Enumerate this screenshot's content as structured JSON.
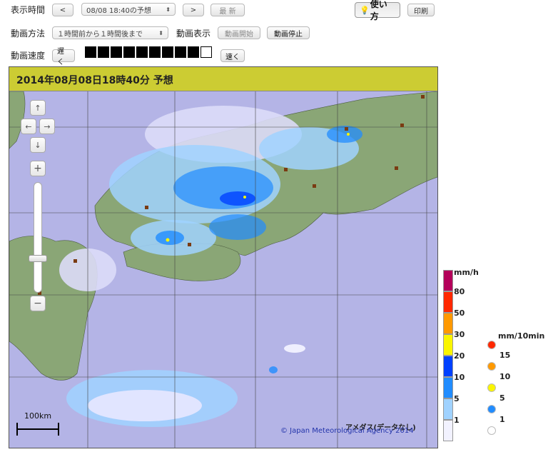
{
  "controls": {
    "display_time_label": "表示時間",
    "prev_button": "<",
    "time_select_value": "08/08 18:40の予想",
    "next_button": ">",
    "latest_button": "最 新",
    "help_button": "使い方",
    "print_button": "印刷",
    "animation_method_label": "動画方法",
    "animation_method_value": "１時間前から１時間後まで",
    "animation_display_label": "動画表示",
    "animation_start_button": "動画開始",
    "animation_stop_button": "動画停止",
    "animation_speed_label": "動画速度",
    "slower_button": "遅く",
    "faster_button": "速く",
    "speed_level": 9,
    "speed_max": 10
  },
  "map": {
    "title": "2014年08月08日18時40分 予想",
    "scale_label": "100km",
    "amedas_note": "アメダス(データなし)",
    "copyright": "© Japan Meteorological Agency 2014",
    "zoom_in": "+",
    "zoom_out": "−",
    "pan_up": "↑",
    "pan_left": "←",
    "pan_right": "→",
    "pan_down": "↓",
    "colors": {
      "sea": "#b4b4e6",
      "land": "#8aa676",
      "header": "#cccc33"
    }
  },
  "legend": {
    "unit": "mm/h",
    "levels": [
      {
        "label": "80",
        "color": "#b4005a"
      },
      {
        "label": "50",
        "color": "#ff2800"
      },
      {
        "label": "30",
        "color": "#ff9900"
      },
      {
        "label": "20",
        "color": "#faf500"
      },
      {
        "label": "10",
        "color": "#0041ff"
      },
      {
        "label": "5",
        "color": "#218cff"
      },
      {
        "label": "1",
        "color": "#a0d2ff"
      },
      {
        "label": "",
        "color": "#f2f2ff"
      }
    ],
    "amedas_unit": "mm/10min",
    "amedas_levels": [
      {
        "label": "15",
        "color": "#ff2800"
      },
      {
        "label": "10",
        "color": "#ff9900"
      },
      {
        "label": "5",
        "color": "#faf500"
      },
      {
        "label": "1",
        "color": "#218cff"
      },
      {
        "label": "",
        "color": "#ffffff"
      }
    ]
  }
}
